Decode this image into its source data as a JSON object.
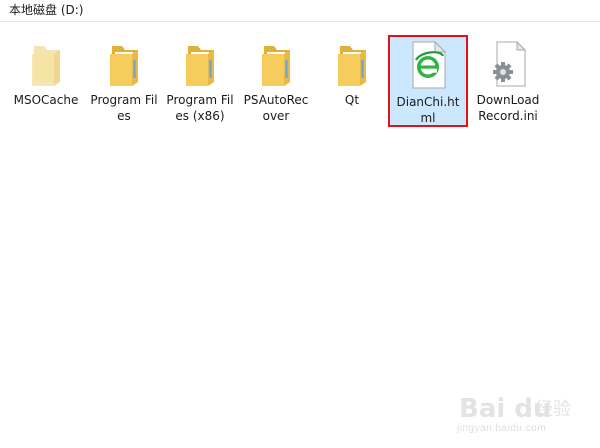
{
  "drive": {
    "title": "本地磁盘 (D:)"
  },
  "items": [
    {
      "label": "MSOCache",
      "type": "folder",
      "icon": "folder-icon"
    },
    {
      "label": "Program Files",
      "type": "folder",
      "icon": "folder-icon"
    },
    {
      "label": "Program Files (x86)",
      "type": "folder",
      "icon": "folder-icon"
    },
    {
      "label": "PSAutoRecover",
      "type": "folder",
      "icon": "folder-icon"
    },
    {
      "label": "Qt",
      "type": "folder",
      "icon": "folder-icon"
    },
    {
      "label": "DianChi.html",
      "type": "html-file",
      "icon": "ie-html-file-icon",
      "selected": true
    },
    {
      "label": "DownLoadRecord.ini",
      "type": "ini-file",
      "icon": "settings-file-icon"
    }
  ],
  "watermark": {
    "name": "Bai du",
    "sub": "经验",
    "url": "jingyan.baidu.com"
  },
  "colors": {
    "selection_fill": "#cce8ff",
    "highlight_box": "#e3101a",
    "folder": "#f3c74b"
  }
}
